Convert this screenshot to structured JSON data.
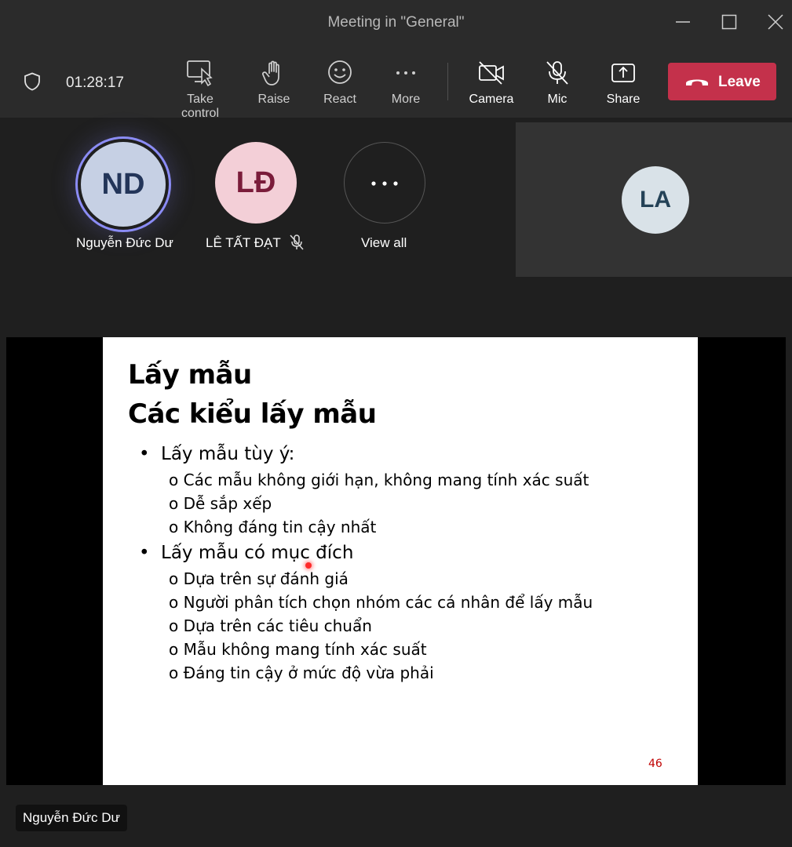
{
  "window": {
    "title": "Meeting in \"General\""
  },
  "toolbar": {
    "timer": "01:28:17",
    "take_control": "Take control",
    "raise": "Raise",
    "react": "React",
    "more": "More",
    "camera": "Camera",
    "mic": "Mic",
    "share": "Share",
    "leave": "Leave"
  },
  "participants": {
    "p1": {
      "initials": "ND",
      "name": "Nguyễn Đức Dư"
    },
    "p2": {
      "initials": "LĐ",
      "name": "LÊ TẤT ĐẠT",
      "muted": true
    },
    "view_all": "View all",
    "p3": {
      "initials": "LA"
    }
  },
  "slide": {
    "title1": "Lấy mẫu",
    "title2": "Các kiểu lấy mẫu",
    "bullets": [
      {
        "text": "Lấy mẫu tùy ý:",
        "sub": [
          "Các mẫu không giới hạn, không mang tính xác suất",
          "Dễ sắp xếp",
          "Không đáng tin cậy nhất"
        ]
      },
      {
        "text": "Lấy mẫu có mục đích",
        "sub": [
          "Dựa trên sự đánh giá",
          "Người phân tích chọn nhóm các cá nhân để lấy mẫu",
          "Dựa trên các tiêu chuẩn",
          "Mẫu không mang tính xác suất",
          "Đáng tin cậy ở mức độ vừa phải"
        ]
      }
    ],
    "bullet_glyph": "•",
    "sub_glyph": "o",
    "page_number": "46"
  },
  "presenter_label": "Nguyễn Đức Dư",
  "colors": {
    "leave": "#c4314b",
    "speaking_ring": "#8b8cf5",
    "page_number": "#c00000"
  }
}
